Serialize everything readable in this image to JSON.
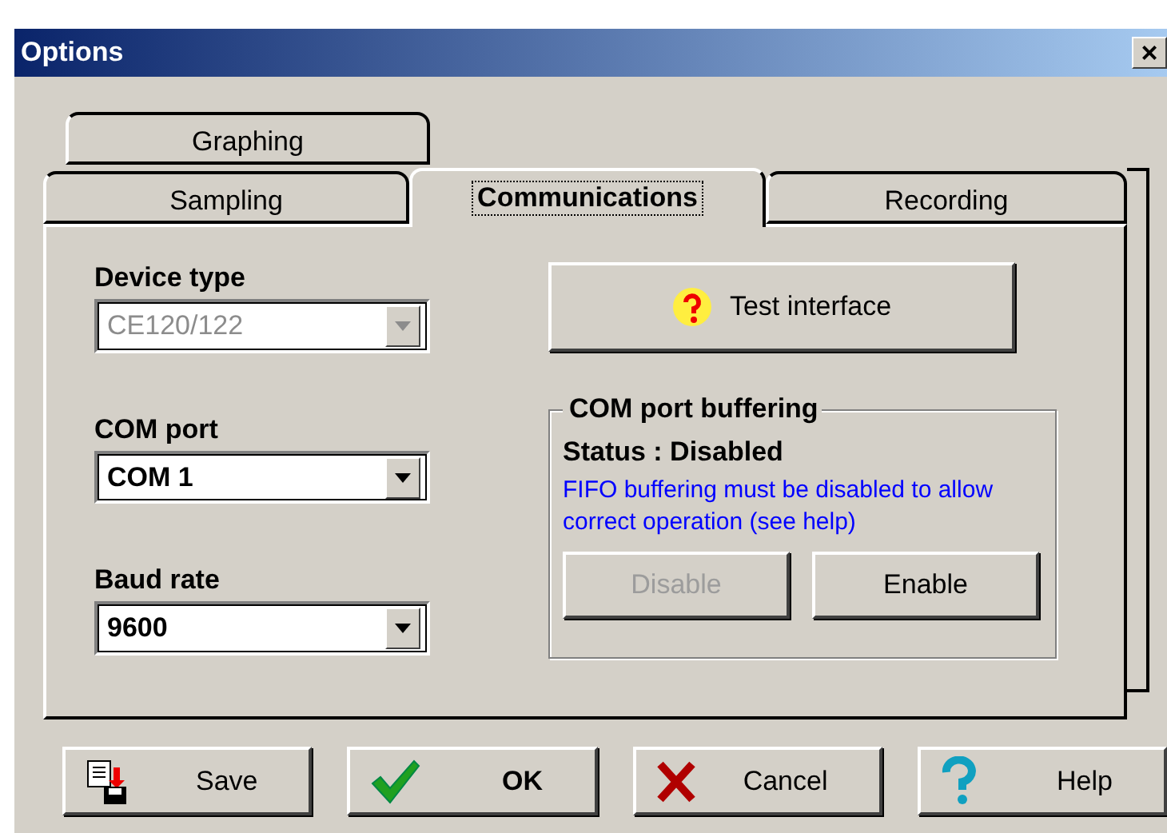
{
  "window": {
    "title": "Options",
    "close": "×"
  },
  "tab_rows": [
    [
      {
        "label": "Graphing",
        "selected": false
      }
    ],
    [
      {
        "label": "Sampling",
        "selected": false
      },
      {
        "label": "Communications",
        "selected": true
      },
      {
        "label": "Recording",
        "selected": false
      }
    ]
  ],
  "fields": [
    {
      "label": "Device type",
      "value": "CE120/122",
      "disabled": true
    },
    {
      "label": "COM port",
      "value": "COM 1",
      "disabled": false
    },
    {
      "label": "Baud rate",
      "value": "9600",
      "disabled": false
    }
  ],
  "test_button": {
    "label": "Test interface"
  },
  "buffering": {
    "title": "COM port buffering",
    "status": "Status : Disabled",
    "note": "FIFO buffering must be disabled to allow correct operation (see help)",
    "buttons": [
      {
        "label": "Disable",
        "disabled": true
      },
      {
        "label": "Enable",
        "disabled": false
      }
    ]
  },
  "buttons": [
    {
      "label": "Save",
      "kind": "save"
    },
    {
      "label": "OK",
      "kind": "ok"
    },
    {
      "label": "Cancel",
      "kind": "cancel"
    },
    {
      "label": "Help",
      "kind": "help"
    }
  ]
}
